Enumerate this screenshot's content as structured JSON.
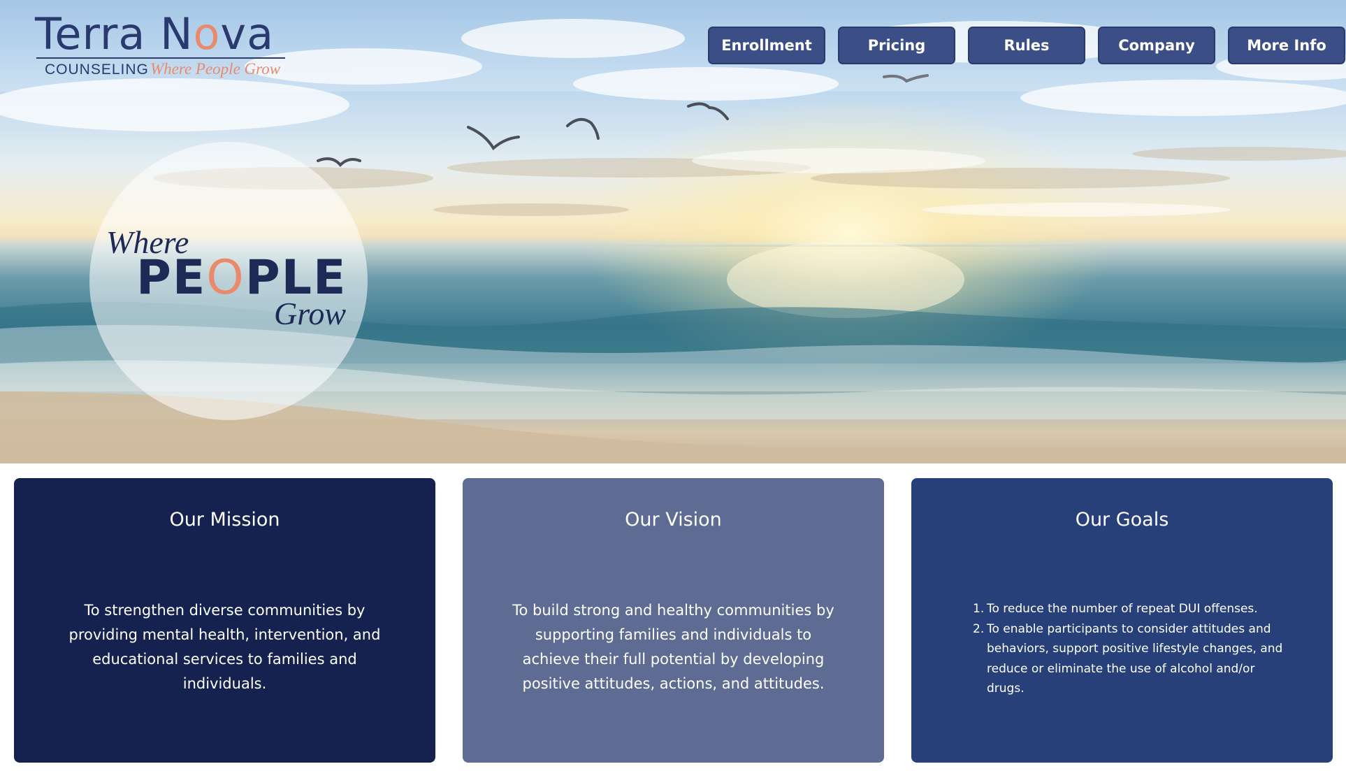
{
  "logo": {
    "name_part1": "Terra N",
    "name_o": "o",
    "name_part2": "va",
    "subtitle": "COUNSELING",
    "tagline": "Where People Grow"
  },
  "nav": {
    "items": [
      {
        "label": "Enrollment"
      },
      {
        "label": "Pricing"
      },
      {
        "label": "Rules"
      },
      {
        "label": "Company"
      },
      {
        "label": "More Info"
      }
    ]
  },
  "hero": {
    "badge": {
      "where": "Where",
      "people_part1": "PE",
      "people_o": "O",
      "people_part2": "PLE",
      "grow": "Grow"
    }
  },
  "cards": {
    "mission": {
      "title": "Our Mission",
      "body": "To strengthen diverse communities by providing mental health, intervention, and educational services to families and individuals."
    },
    "vision": {
      "title": "Our Vision",
      "body": "To build strong and healthy communities by supporting families and individuals to achieve their full potential by developing positive attitudes, actions, and attitudes."
    },
    "goals": {
      "title": "Our Goals",
      "items": [
        {
          "num": "1.",
          "text": "To reduce the number of repeat DUI offenses."
        },
        {
          "num": "2.",
          "text": "To enable participants to consider attitudes and behaviors, support positive lifestyle changes, and reduce or eliminate the use of alcohol and/or drugs."
        }
      ]
    }
  },
  "colors": {
    "navy": "#15224f",
    "slate": "#5e6b93",
    "royal": "#28407a",
    "nav_button": "#3b4f86",
    "accent_coral": "#e98a6d"
  }
}
